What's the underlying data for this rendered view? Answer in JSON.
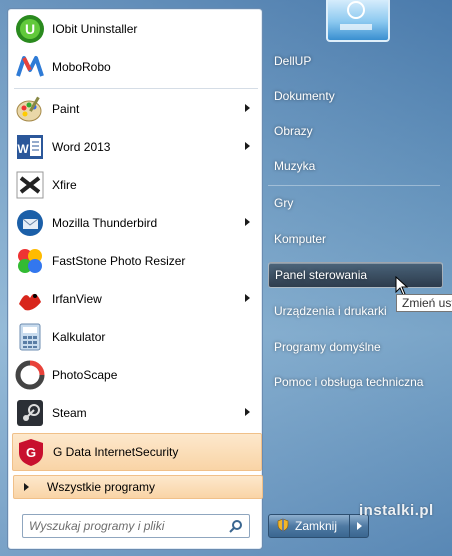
{
  "programs": [
    {
      "label": "IObit Uninstaller",
      "icon": "iobit-uninstaller-icon",
      "submenu": false
    },
    {
      "label": "MoboRobo",
      "icon": "moborobo-icon",
      "submenu": false
    },
    {
      "label": "Paint",
      "icon": "paint-icon",
      "submenu": true
    },
    {
      "label": "Word 2013",
      "icon": "word-icon",
      "submenu": true
    },
    {
      "label": "Xfire",
      "icon": "xfire-icon",
      "submenu": false
    },
    {
      "label": "Mozilla Thunderbird",
      "icon": "thunderbird-icon",
      "submenu": true
    },
    {
      "label": "FastStone Photo Resizer",
      "icon": "faststone-icon",
      "submenu": false
    },
    {
      "label": "IrfanView",
      "icon": "irfanview-icon",
      "submenu": true
    },
    {
      "label": "Kalkulator",
      "icon": "calculator-icon",
      "submenu": false
    },
    {
      "label": "PhotoScape",
      "icon": "photoscape-icon",
      "submenu": false
    },
    {
      "label": "Steam",
      "icon": "steam-icon",
      "submenu": true
    },
    {
      "label": "G Data InternetSecurity",
      "icon": "gdata-icon",
      "submenu": false
    }
  ],
  "all_programs_label": "Wszystkie programy",
  "search": {
    "placeholder": "Wyszukaj programy i pliki"
  },
  "right_items": [
    {
      "label": "DellUP"
    },
    {
      "label": "Dokumenty"
    },
    {
      "label": "Obrazy"
    },
    {
      "label": "Muzyka"
    },
    {
      "label": "Gry"
    },
    {
      "label": "Komputer"
    },
    {
      "label": "Panel sterowania"
    },
    {
      "label": "Urządzenia i drukarki"
    },
    {
      "label": "Programy domyślne"
    },
    {
      "label": "Pomoc i obsługa techniczna"
    }
  ],
  "shutdown_label": "Zamknij",
  "tooltip": "Zmień ust",
  "watermark": {
    "brand": "instalki",
    "suffix": ".pl"
  },
  "colors": {
    "highlight": "#f9d4a6",
    "gdata_red": "#c8102e",
    "word_blue": "#2b579a"
  }
}
